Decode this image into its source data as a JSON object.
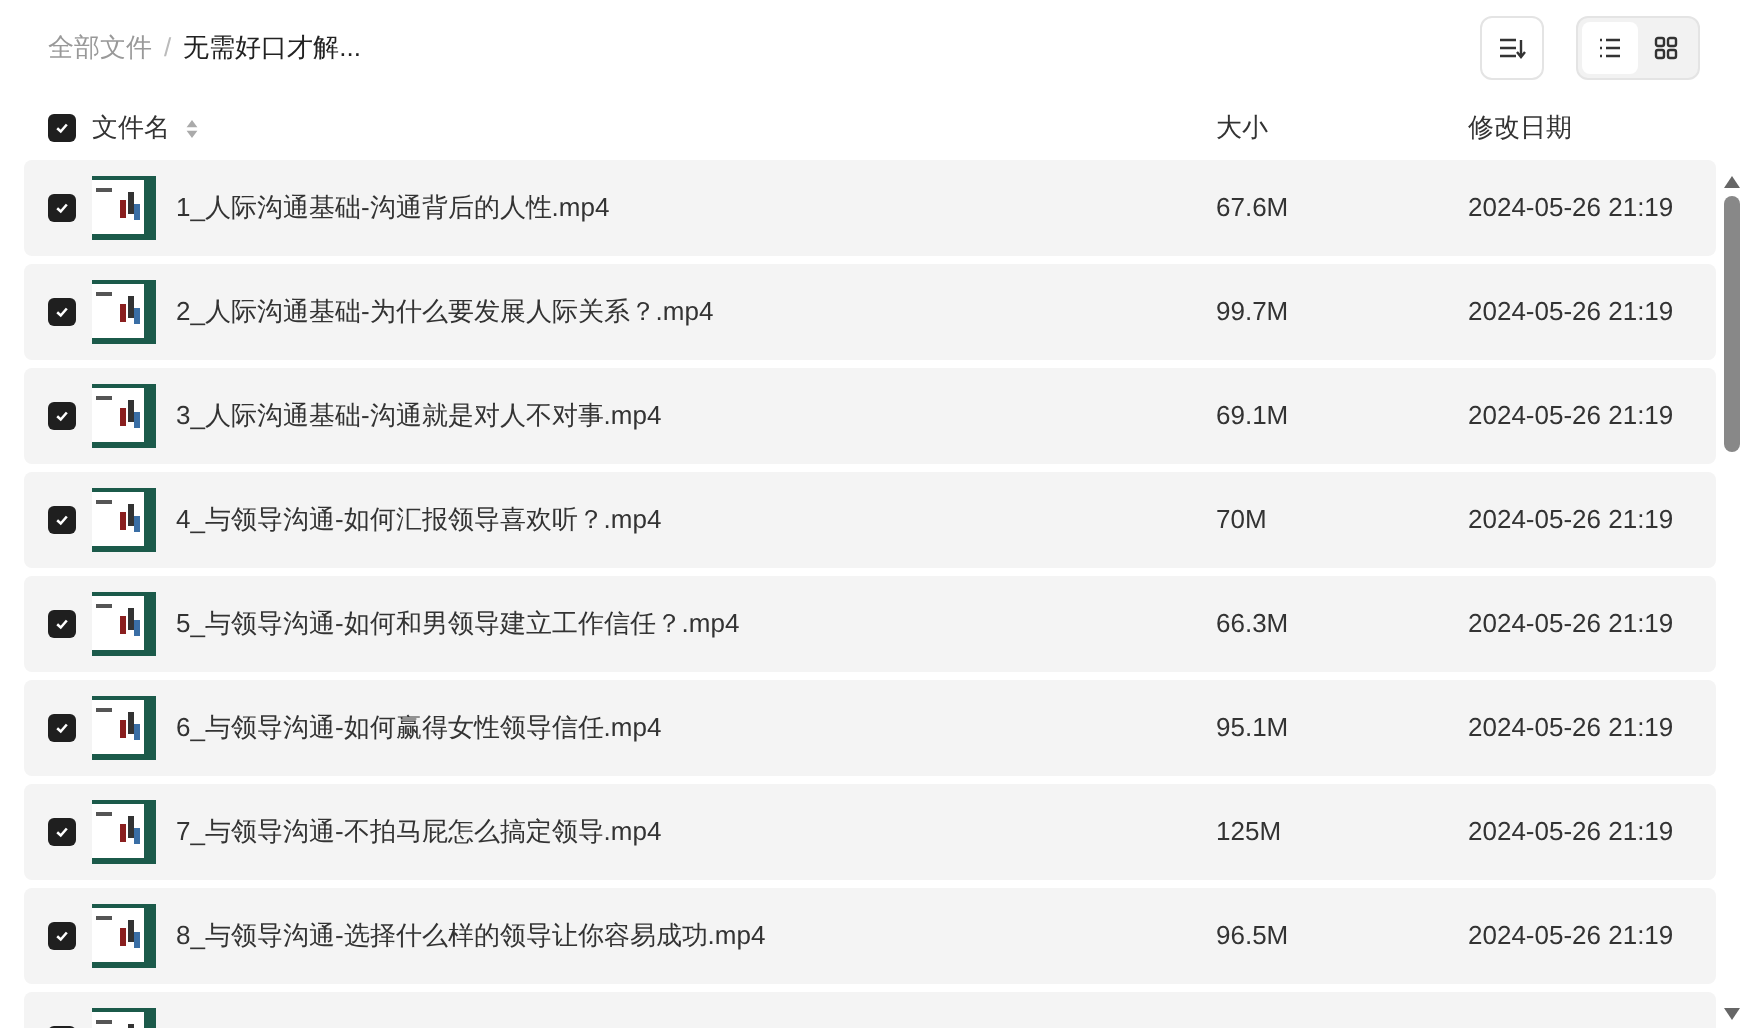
{
  "breadcrumb": {
    "separator": "/",
    "items": [
      {
        "label": "全部文件",
        "current": false
      },
      {
        "label": "无需好口才解...",
        "current": true
      }
    ]
  },
  "toolbar": {
    "view_modes": [
      {
        "kind": "list",
        "selected": true
      },
      {
        "kind": "grid",
        "selected": false
      }
    ]
  },
  "table": {
    "select_all": {
      "checked": true
    },
    "columns": [
      "文件名",
      "大小",
      "修改日期"
    ],
    "rows": [
      {
        "checked": true,
        "name": "1_人际沟通基础-沟通背后的人性.mp4",
        "size": "67.6M",
        "modified": "2024-05-26 21:19"
      },
      {
        "checked": true,
        "name": "2_人际沟通基础-为什么要发展人际关系？.mp4",
        "size": "99.7M",
        "modified": "2024-05-26 21:19"
      },
      {
        "checked": true,
        "name": "3_人际沟通基础-沟通就是对人不对事.mp4",
        "size": "69.1M",
        "modified": "2024-05-26 21:19"
      },
      {
        "checked": true,
        "name": "4_与领导沟通-如何汇报领导喜欢听？.mp4",
        "size": "70M",
        "modified": "2024-05-26 21:19"
      },
      {
        "checked": true,
        "name": "5_与领导沟通-如何和男领导建立工作信任？.mp4",
        "size": "66.3M",
        "modified": "2024-05-26 21:19"
      },
      {
        "checked": true,
        "name": "6_与领导沟通-如何赢得女性领导信任.mp4",
        "size": "95.1M",
        "modified": "2024-05-26 21:19"
      },
      {
        "checked": true,
        "name": "7_与领导沟通-不拍马屁怎么搞定领导.mp4",
        "size": "125M",
        "modified": "2024-05-26 21:19"
      },
      {
        "checked": true,
        "name": "8_与领导沟通-选择什么样的领导让你容易成功.mp4",
        "size": "96.5M",
        "modified": "2024-05-26 21:19"
      },
      {
        "checked": true
      }
    ]
  }
}
